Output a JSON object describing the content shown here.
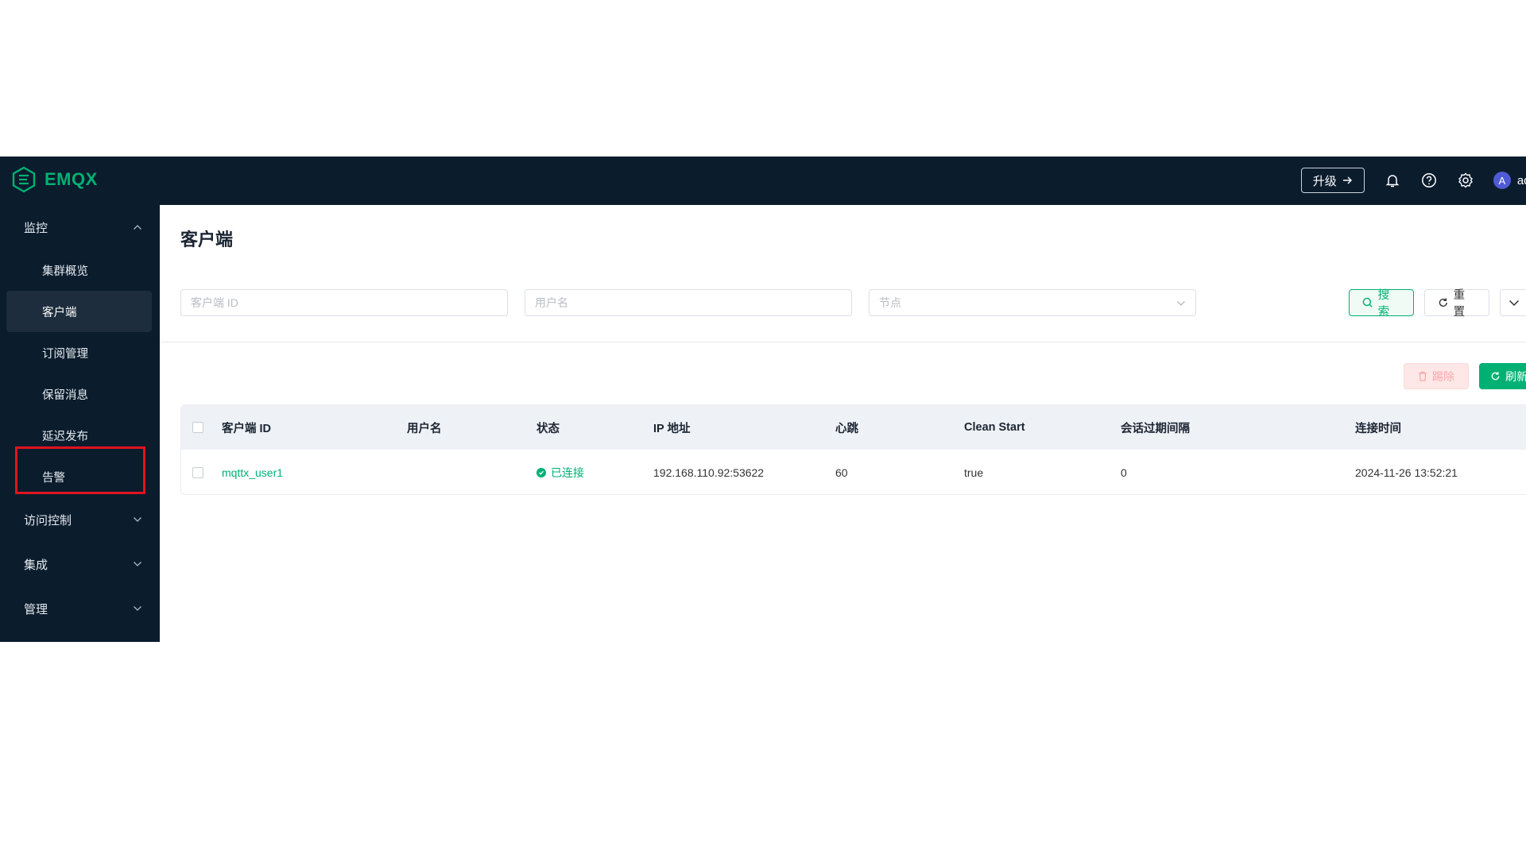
{
  "brand": {
    "name": "EMQX",
    "accent": "#00b173"
  },
  "header": {
    "upgrade_label": "升级",
    "icons": [
      "bell-icon",
      "help-icon",
      "settings-icon"
    ],
    "user": {
      "avatar_letter": "A",
      "name": "adm"
    }
  },
  "sidebar": {
    "monitor": {
      "label": "监控",
      "items": [
        {
          "label": "集群概览"
        },
        {
          "label": "客户端"
        },
        {
          "label": "订阅管理"
        },
        {
          "label": "保留消息"
        },
        {
          "label": "延迟发布"
        },
        {
          "label": "告警"
        }
      ],
      "active": "客户端"
    },
    "groups": [
      {
        "label": "访问控制"
      },
      {
        "label": "集成"
      },
      {
        "label": "管理"
      }
    ]
  },
  "page": {
    "title": "客户端",
    "filters": {
      "client_id_placeholder": "客户端 ID",
      "username_placeholder": "用户名",
      "node_placeholder": "节点"
    },
    "buttons": {
      "search": "搜索",
      "reset": "重置",
      "kick": "踢除",
      "refresh": "刷新"
    }
  },
  "table": {
    "columns": [
      "客户端 ID",
      "用户名",
      "状态",
      "IP 地址",
      "心跳",
      "Clean Start",
      "会话过期间隔",
      "连接时间"
    ],
    "rows": [
      {
        "client_id": "mqttx_user1",
        "username": "",
        "status": "已连接",
        "ip": "192.168.110.92:53622",
        "keepalive": "60",
        "clean_start": "true",
        "expiry": "0",
        "connected_at": "2024-11-26 13:52:21"
      }
    ]
  }
}
